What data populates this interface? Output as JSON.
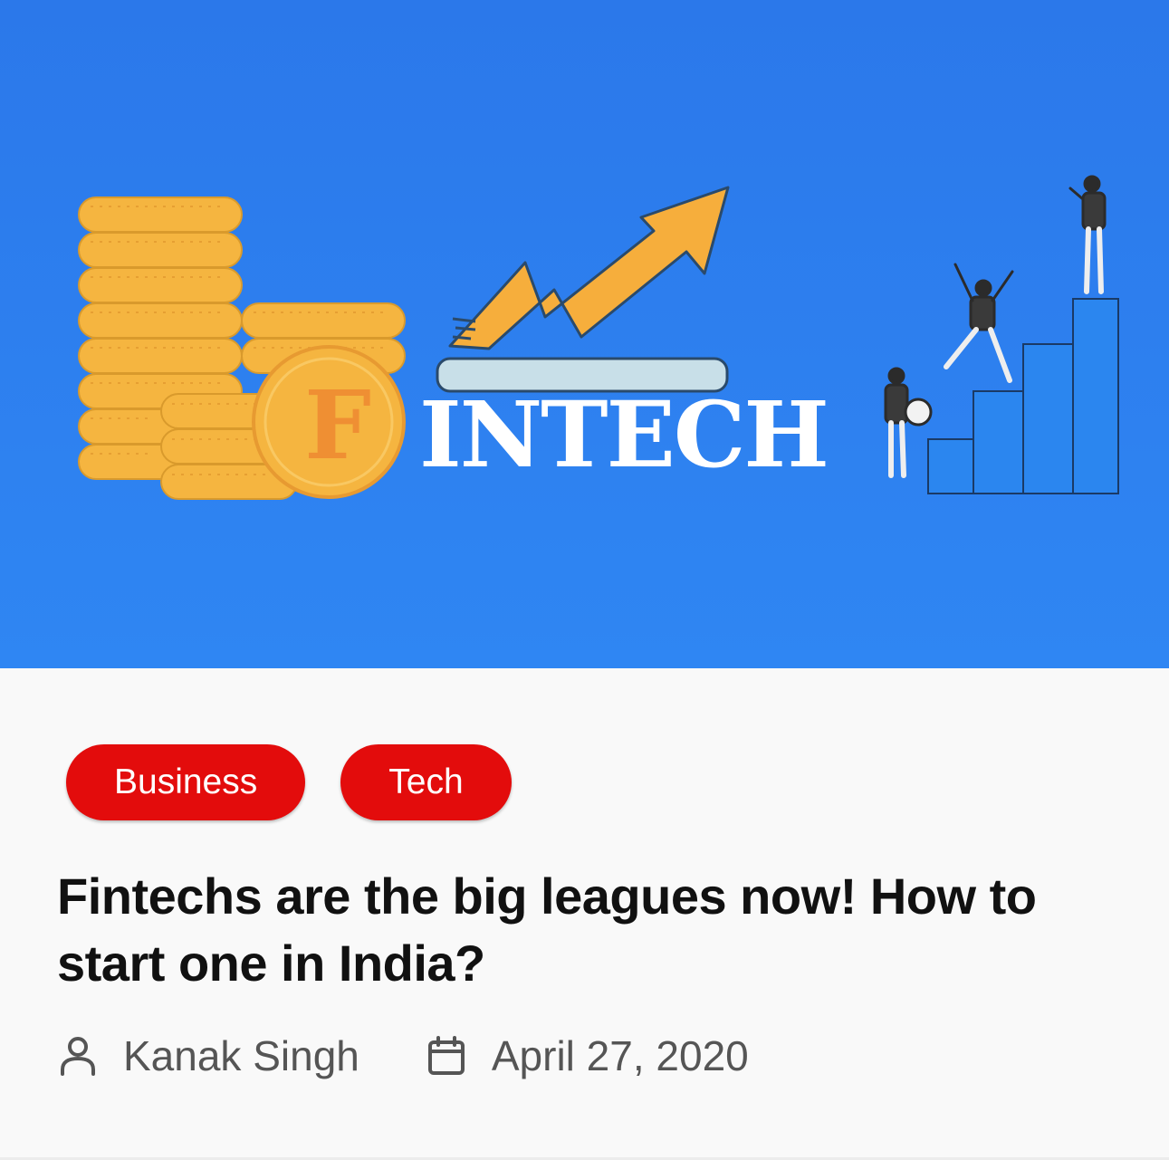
{
  "hero": {
    "image_icon": "fintech-illustration",
    "coin_letter": "F",
    "word": "INTECH",
    "colors": {
      "background": "#2b78ea",
      "coin": "#f5b540",
      "coin_letter": "#ef8f33",
      "arrow": "#f6ae3c",
      "bars": "#2b86ef"
    }
  },
  "tags": [
    {
      "label": "Business"
    },
    {
      "label": "Tech"
    }
  ],
  "article": {
    "title": "Fintechs are the big leagues now! How to start one in India?"
  },
  "meta": {
    "author_icon": "user-icon",
    "author": "Kanak Singh",
    "date_icon": "calendar-icon",
    "date": "April 27, 2020"
  },
  "colors": {
    "tag_background": "#e30c0c",
    "tag_text": "#ffffff",
    "title_text": "#111111",
    "meta_text": "#555555"
  }
}
